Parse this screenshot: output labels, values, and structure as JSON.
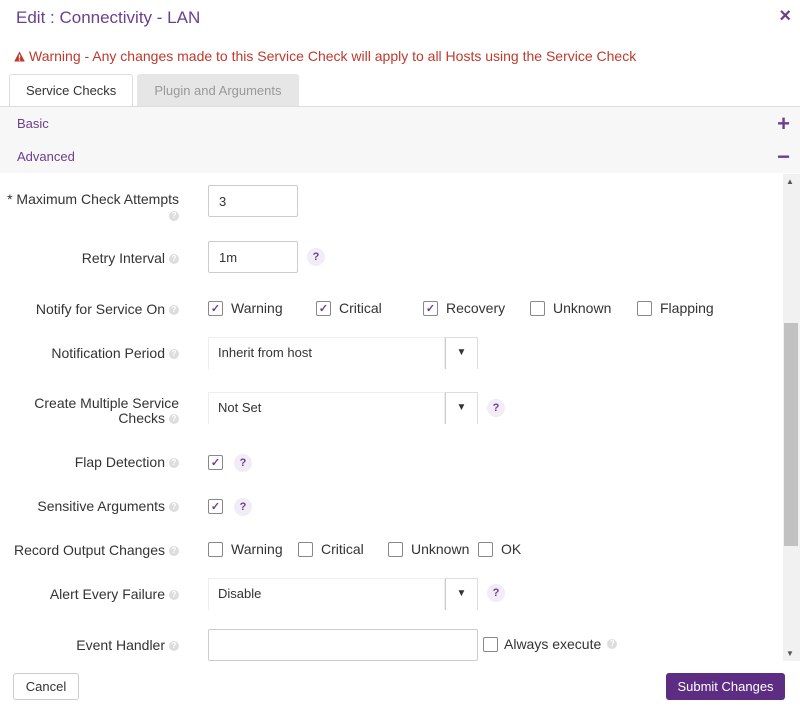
{
  "dialog": {
    "title": "Edit : Connectivity - LAN",
    "close_icon": "×",
    "warning": "Warning - Any changes made to this Service Check will apply to all Hosts using the Service Check"
  },
  "tabs": [
    {
      "label": "Service Checks",
      "active": true
    },
    {
      "label": "Plugin and Arguments",
      "active": false
    }
  ],
  "sections": {
    "basic": {
      "label": "Basic",
      "toggle": "+"
    },
    "advanced": {
      "label": "Advanced",
      "toggle": "−"
    }
  },
  "form": {
    "max_check_attempts": {
      "label": "* Maximum Check Attempts",
      "value": "3"
    },
    "retry_interval": {
      "label": "Retry Interval",
      "value": "1m"
    },
    "notify_for_service_on": {
      "label": "Notify for Service On",
      "options": [
        {
          "label": "Warning",
          "checked": true
        },
        {
          "label": "Critical",
          "checked": true
        },
        {
          "label": "Recovery",
          "checked": true
        },
        {
          "label": "Unknown",
          "checked": false
        },
        {
          "label": "Flapping",
          "checked": false
        }
      ]
    },
    "notification_period": {
      "label": "Notification Period",
      "value": "Inherit from host"
    },
    "create_multiple": {
      "label_line1": "Create Multiple Service",
      "label_line2": "Checks",
      "value": "Not Set"
    },
    "flap_detection": {
      "label": "Flap Detection",
      "checked": true
    },
    "sensitive_arguments": {
      "label": "Sensitive Arguments",
      "checked": true
    },
    "record_output_changes": {
      "label": "Record Output Changes",
      "options": [
        {
          "label": "Warning",
          "checked": false
        },
        {
          "label": "Critical",
          "checked": false
        },
        {
          "label": "Unknown",
          "checked": false
        },
        {
          "label": "OK",
          "checked": false
        }
      ]
    },
    "alert_every_failure": {
      "label": "Alert Every Failure",
      "value": "Disable"
    },
    "event_handler": {
      "label": "Event Handler",
      "value": "",
      "always_execute": "Always execute"
    }
  },
  "help": {
    "dot": "?",
    "q": "?"
  },
  "check_mark": "✓",
  "dropdown_arrow": "▼",
  "buttons": {
    "cancel": "Cancel",
    "submit": "Submit Changes"
  },
  "scroll": {
    "up": "▲",
    "down": "▼"
  },
  "colors": {
    "accent": "#6b3f8e",
    "warning": "#c0392b",
    "submit_bg": "#5c2d82"
  }
}
